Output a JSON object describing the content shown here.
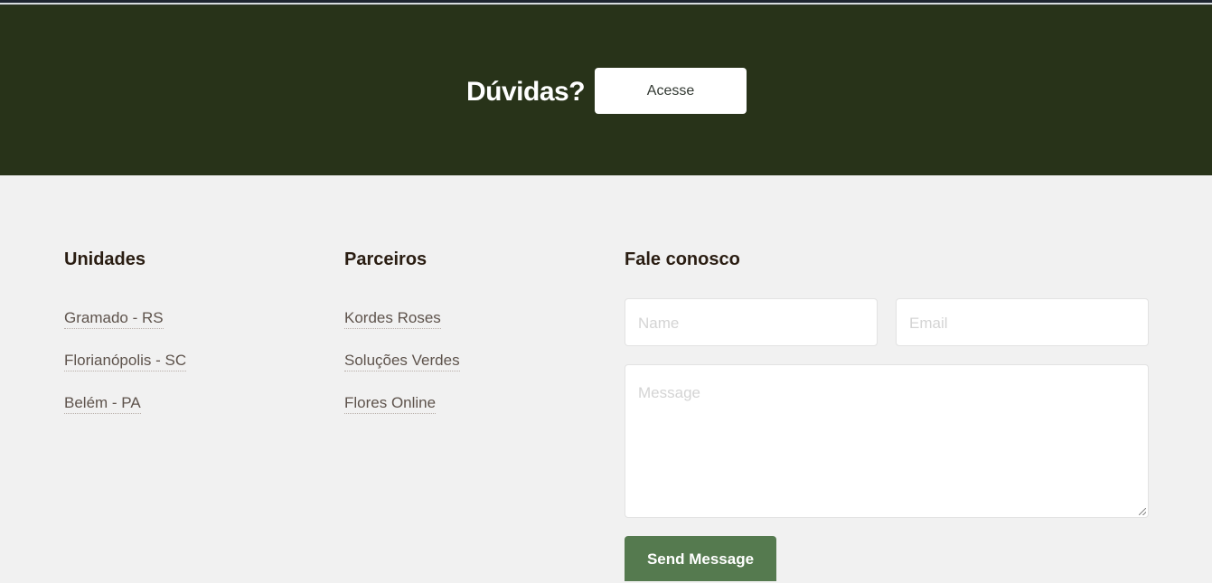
{
  "banner": {
    "title": "Dúvidas?",
    "button_label": "Acesse"
  },
  "footer": {
    "unidades": {
      "title": "Unidades",
      "links": [
        "Gramado - RS",
        "Florianópolis - SC",
        "Belém - PA"
      ]
    },
    "parceiros": {
      "title": "Parceiros",
      "links": [
        "Kordes Roses",
        "Soluções Verdes",
        "Flores Online"
      ]
    },
    "contact": {
      "title": "Fale conosco",
      "name_placeholder": "Name",
      "email_placeholder": "Email",
      "message_placeholder": "Message",
      "send_label": "Send Message"
    }
  },
  "colors": {
    "banner_bg": "#283319",
    "footer_bg": "#f1f1f1",
    "send_button_bg": "#557a4f"
  }
}
